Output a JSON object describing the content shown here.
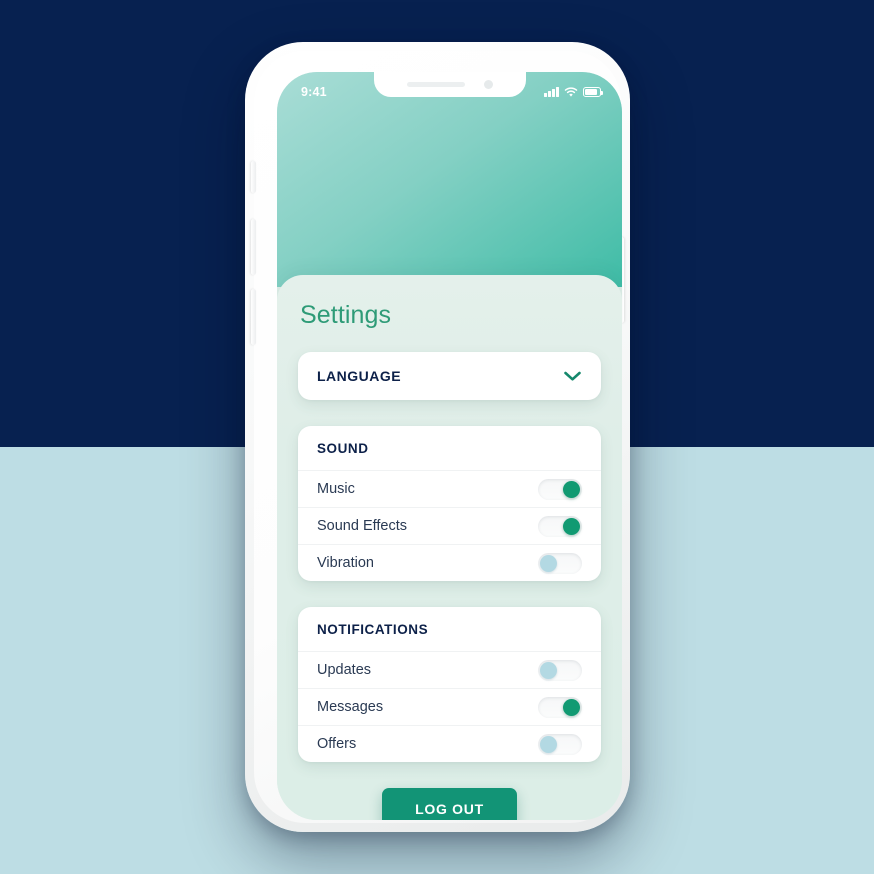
{
  "background": {
    "top_color": "#072150",
    "bottom_color": "#bddde4"
  },
  "device": {
    "frame_color": "#ffffff",
    "buttons": {
      "silent_switch": "silent-switch",
      "volume_up": "volume-up-button",
      "volume_down": "volume-down-button",
      "power": "power-button"
    }
  },
  "status_bar": {
    "time": "9:41",
    "icons": [
      "cellular-signal-icon",
      "wifi-icon",
      "battery-icon"
    ]
  },
  "screen": {
    "hero_gradient_from": "#a9ddd6",
    "hero_gradient_to": "#3fbca6"
  },
  "page": {
    "title": "Settings",
    "title_color": "#2e9b77"
  },
  "language": {
    "label": "LANGUAGE",
    "chevron_icon": "chevron-down-icon",
    "chevron_color": "#15886c"
  },
  "groups": [
    {
      "header": "SOUND",
      "rows": [
        {
          "label": "Music",
          "enabled": true
        },
        {
          "label": "Sound Effects",
          "enabled": true
        },
        {
          "label": "Vibration",
          "enabled": false
        }
      ]
    },
    {
      "header": "NOTIFICATIONS",
      "rows": [
        {
          "label": "Updates",
          "enabled": false
        },
        {
          "label": "Messages",
          "enabled": true
        },
        {
          "label": "Offers",
          "enabled": false
        }
      ]
    }
  ],
  "toggle_colors": {
    "on": "#119a72",
    "off": "#b3d9e3",
    "track": "#f7f8f9"
  },
  "logout": {
    "label": "LOG OUT",
    "background": "#129476",
    "text_color": "#ffffff"
  }
}
